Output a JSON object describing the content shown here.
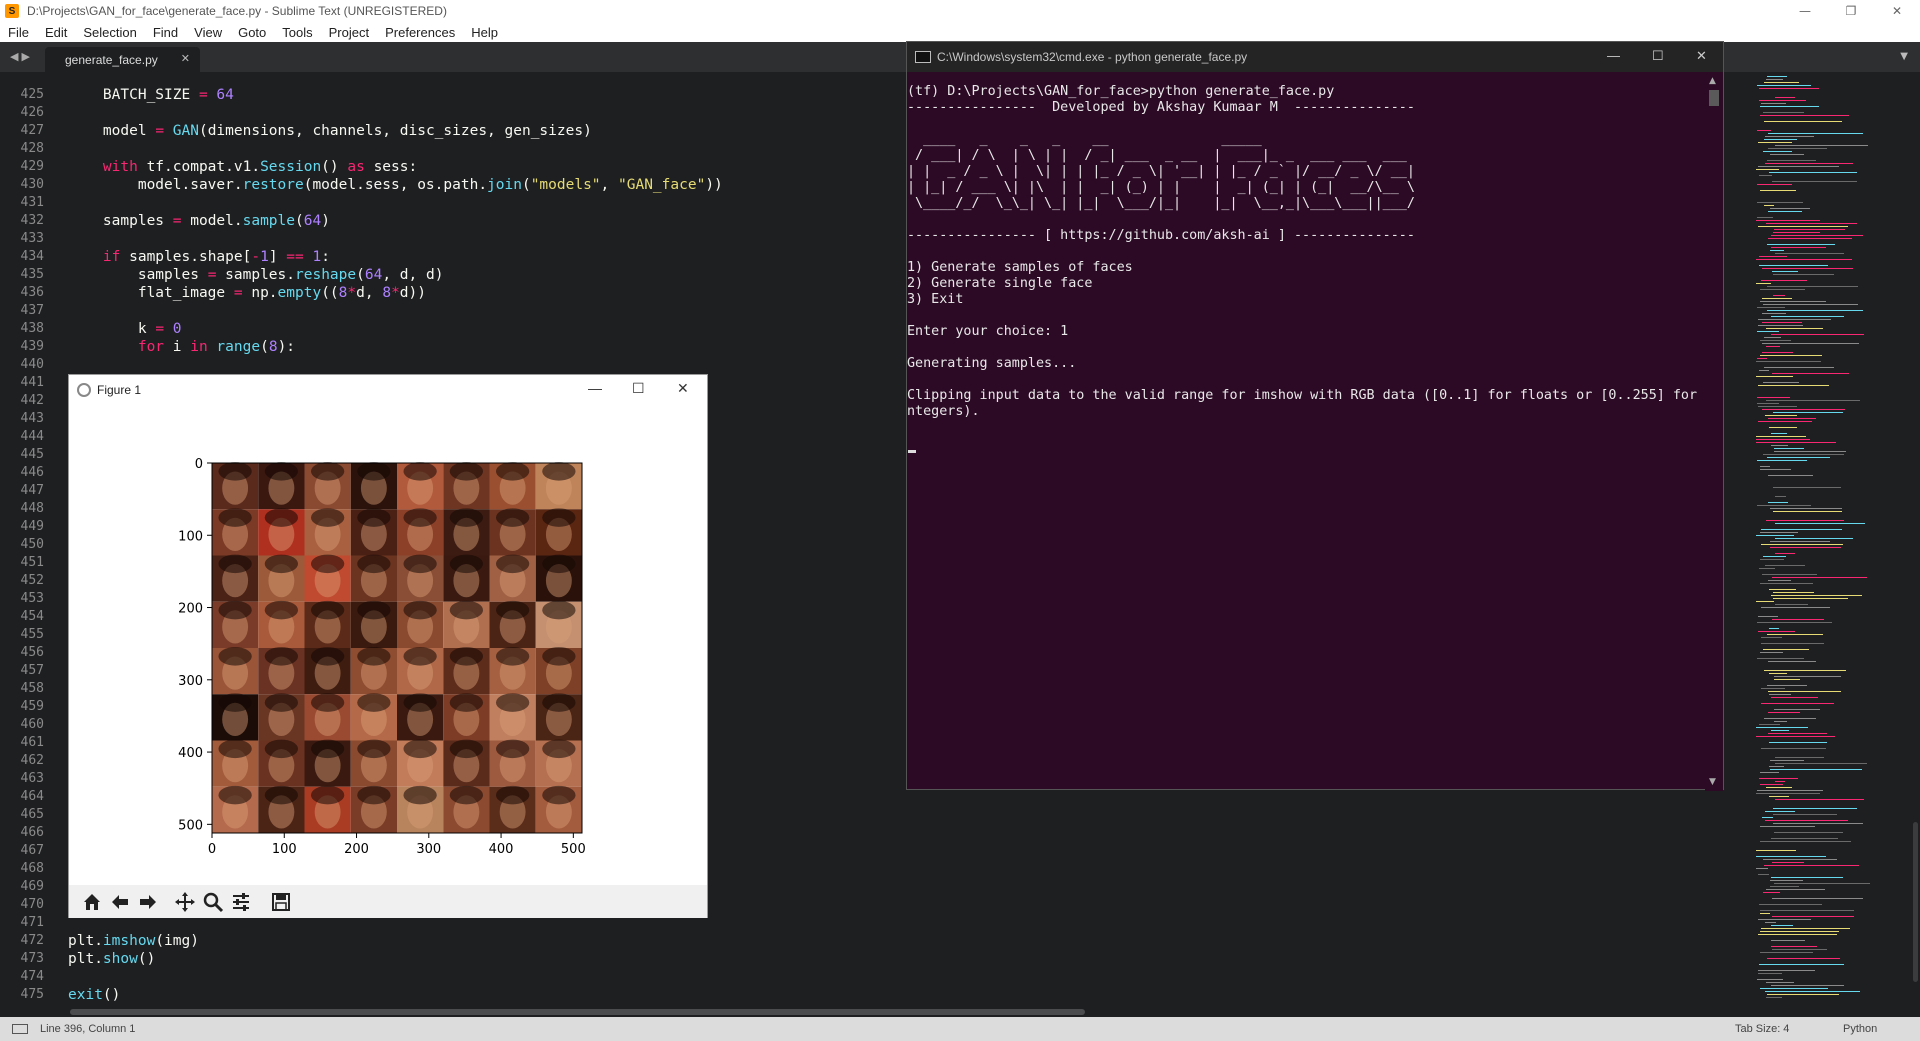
{
  "sublime": {
    "window_title": "D:\\Projects\\GAN_for_face\\generate_face.py - Sublime Text (UNREGISTERED)",
    "menu": [
      "File",
      "Edit",
      "Selection",
      "Find",
      "View",
      "Goto",
      "Tools",
      "Project",
      "Preferences",
      "Help"
    ],
    "tab_label": "generate_face.py",
    "line_numbers": [
      "425",
      "426",
      "427",
      "428",
      "429",
      "430",
      "431",
      "432",
      "433",
      "434",
      "435",
      "436",
      "437",
      "438",
      "439",
      "440",
      "441",
      "442",
      "443",
      "444",
      "445",
      "446",
      "447",
      "448",
      "449",
      "450",
      "451",
      "452",
      "453",
      "454",
      "455",
      "456",
      "457",
      "458",
      "459",
      "460",
      "461",
      "462",
      "463",
      "464",
      "465",
      "466",
      "467",
      "468",
      "469",
      "470",
      "471",
      "472",
      "473",
      "474",
      "475"
    ],
    "code_lines": [
      {
        "row": 0,
        "tokens": [
          [
            "",
            "    BATCH_SIZE "
          ],
          [
            "kw",
            "="
          ],
          [
            "nm",
            " 64"
          ]
        ]
      },
      {
        "row": 2,
        "tokens": [
          [
            "",
            "    model "
          ],
          [
            "kw",
            "="
          ],
          [
            "fn",
            " GAN"
          ],
          [
            "",
            "(dimensions, channels, disc_sizes, gen_sizes)"
          ]
        ]
      },
      {
        "row": 4,
        "tokens": [
          [
            "kw",
            "    with"
          ],
          [
            "",
            " tf.compat.v1."
          ],
          [
            "fn",
            "Session"
          ],
          [
            "",
            "() "
          ],
          [
            "kw",
            "as"
          ],
          [
            "",
            " sess:"
          ]
        ]
      },
      {
        "row": 5,
        "tokens": [
          [
            "",
            "        model.saver."
          ],
          [
            "fn",
            "restore"
          ],
          [
            "",
            "(model.sess, os.path."
          ],
          [
            "fn",
            "join"
          ],
          [
            "",
            "("
          ],
          [
            "st",
            "\"models\""
          ],
          [
            "",
            ", "
          ],
          [
            "st",
            "\"GAN_face\""
          ],
          [
            "",
            "))"
          ]
        ]
      },
      {
        "row": 7,
        "tokens": [
          [
            "",
            "    samples "
          ],
          [
            "kw",
            "="
          ],
          [
            "",
            " model."
          ],
          [
            "fn",
            "sample"
          ],
          [
            "",
            "("
          ],
          [
            "nm",
            "64"
          ],
          [
            "",
            ")"
          ]
        ]
      },
      {
        "row": 9,
        "tokens": [
          [
            "kw",
            "    if"
          ],
          [
            "",
            " samples.shape["
          ],
          [
            "kw",
            "-"
          ],
          [
            "nm",
            "1"
          ],
          [
            "",
            "] "
          ],
          [
            "kw",
            "=="
          ],
          [
            "nm",
            " 1"
          ],
          [
            "",
            ":"
          ]
        ]
      },
      {
        "row": 10,
        "tokens": [
          [
            "",
            "        samples "
          ],
          [
            "kw",
            "="
          ],
          [
            "",
            " samples."
          ],
          [
            "fn",
            "reshape"
          ],
          [
            "",
            "("
          ],
          [
            "nm",
            "64"
          ],
          [
            "",
            ", d, d)"
          ]
        ]
      },
      {
        "row": 11,
        "tokens": [
          [
            "",
            "        flat_image "
          ],
          [
            "kw",
            "="
          ],
          [
            "",
            " np."
          ],
          [
            "fn",
            "empty"
          ],
          [
            "",
            "(("
          ],
          [
            "nm",
            "8"
          ],
          [
            "kw",
            "*"
          ],
          [
            "",
            "d, "
          ],
          [
            "nm",
            "8"
          ],
          [
            "kw",
            "*"
          ],
          [
            "",
            "d))"
          ]
        ]
      },
      {
        "row": 13,
        "tokens": [
          [
            "",
            "        k "
          ],
          [
            "kw",
            "="
          ],
          [
            "nm",
            " 0"
          ]
        ]
      },
      {
        "row": 14,
        "tokens": [
          [
            "kw",
            "        for"
          ],
          [
            "",
            " i "
          ],
          [
            "kw",
            "in"
          ],
          [
            "fn",
            " range"
          ],
          [
            "",
            "("
          ],
          [
            "nm",
            "8"
          ],
          [
            "",
            "):"
          ]
        ]
      },
      {
        "row": 47,
        "tokens": [
          [
            "",
            "plt."
          ],
          [
            "fn",
            "imshow"
          ],
          [
            "",
            "(img)"
          ]
        ]
      },
      {
        "row": 48,
        "tokens": [
          [
            "",
            "plt."
          ],
          [
            "fn",
            "show"
          ],
          [
            "",
            "()"
          ]
        ]
      },
      {
        "row": 50,
        "tokens": [
          [
            "fn",
            "exit"
          ],
          [
            "",
            "()"
          ]
        ]
      }
    ],
    "status_position": "Line 396, Column 1",
    "status_tab_size": "Tab Size: 4",
    "status_syntax": "Python",
    "colors": {
      "background": "#1d1f21",
      "keyword": "#f92672",
      "function": "#66d9ef",
      "number": "#ae81ff",
      "string": "#e6db74"
    }
  },
  "cmd": {
    "title": "C:\\Windows\\system32\\cmd.exe - python  generate_face.py",
    "lines": [
      "(tf) D:\\Projects\\GAN_for_face>python generate_face.py",
      "----------------  Developed by Akshay Kumaar M  ---------------",
      "",
      "  ____   _    _   _    __              _____",
      " / ___| / \\  | \\ | |  / _| ___  _ __  |  ___|_ _  ___ ___  ___",
      "| |  _ / _ \\ |  \\| | | |_ / _ \\| '__| | |_ / _` |/ __/ _ \\/ __|",
      "| |_| / ___ \\| |\\  | |  _| (_) | |    |  _| (_| | (_|  __/\\__ \\",
      " \\____/_/  \\_\\_| \\_| |_|  \\___/|_|    |_|  \\__,_|\\___\\___||___/",
      "",
      "---------------- [ https://github.com/aksh-ai ] ---------------",
      "",
      "1) Generate samples of faces",
      "2) Generate single face",
      "3) Exit",
      "",
      "Enter your choice: 1",
      "",
      "Generating samples...",
      "",
      "Clipping input data to the valid range for imshow with RGB data ([0..1] for floats or [0..255] for i",
      "ntegers)."
    ],
    "background": "#2c0a25"
  },
  "figure": {
    "title": "Figure 1",
    "grid": 8,
    "chart_data": {
      "type": "image",
      "title": "",
      "x_ticks": [
        "0",
        "100",
        "200",
        "300",
        "400",
        "500"
      ],
      "y_ticks": [
        "0",
        "100",
        "200",
        "300",
        "400",
        "500"
      ],
      "xlim": [
        0,
        512
      ],
      "ylim": [
        512,
        0
      ],
      "tile_colors": [
        "#5a2a1c",
        "#3a1810",
        "#8a4a32",
        "#2b130c",
        "#b25a3c",
        "#6e3522",
        "#9a5030",
        "#c0845a",
        "#7a3a26",
        "#b03020",
        "#a86040",
        "#4a2014",
        "#8c4028",
        "#3c1c12",
        "#6c3420",
        "#5a2612",
        "#4a2216",
        "#9c5a3a",
        "#c04a30",
        "#6a3420",
        "#8a4e36",
        "#3a1a10",
        "#a06044",
        "#2a120a",
        "#7a3c28",
        "#a85a3a",
        "#5c2a18",
        "#3a1a0e",
        "#8a4a30",
        "#b07050",
        "#4c2416",
        "#c49070",
        "#9a5438",
        "#6a3222",
        "#3e1c10",
        "#8e4c30",
        "#b06848",
        "#5e2c1a",
        "#a46040",
        "#7e4026",
        "#1c0c08",
        "#6a3624",
        "#9a4a30",
        "#b46a48",
        "#3a1a10",
        "#7c3c26",
        "#c08060",
        "#4a2414",
        "#a25c3c",
        "#6a3220",
        "#3a1a10",
        "#8a4a30",
        "#c27c5a",
        "#5a2a1a",
        "#9e5a3e",
        "#b47050",
        "#b46a4c",
        "#4c2416",
        "#aa3c24",
        "#7a3c26",
        "#b8845e",
        "#8c4a30",
        "#5a2c1a",
        "#a45c3e"
      ]
    },
    "toolbar": [
      {
        "name": "home-icon",
        "glyph": "home"
      },
      {
        "name": "back-icon",
        "glyph": "back"
      },
      {
        "name": "forward-icon",
        "glyph": "forward"
      },
      {
        "name": "pan-icon",
        "glyph": "pan"
      },
      {
        "name": "zoom-icon",
        "glyph": "zoom"
      },
      {
        "name": "configure-subplots-icon",
        "glyph": "sliders"
      },
      {
        "name": "save-icon",
        "glyph": "save"
      }
    ]
  }
}
